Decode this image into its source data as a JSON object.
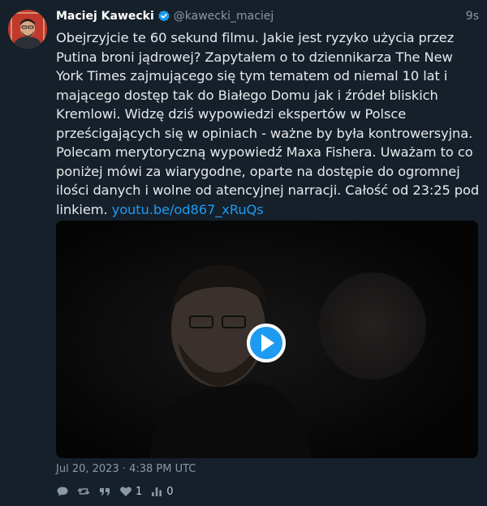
{
  "author": {
    "name": "Maciej Kawecki",
    "handle": "@kawecki_maciej",
    "verified": true
  },
  "time_ago": "9s",
  "tweet": {
    "text": "Obejrzyjcie te 60 sekund filmu. Jakie jest ryzyko użycia przez Putina broni jądrowej? Zapytałem o to dziennikarza The New York Times zajmującego się tym tematem od niemal 10 lat i mającego dostęp tak do Białego Domu jak i źródeł bliskich Kremlowi. Widzę dziś wypowiedzi ekspertów w Polsce prześcigających się w opiniach - ważne by była kontrowersyjna. Polecam merytoryczną wypowiedź Maxa Fishera. Uważam to co poniżej mówi za wiarygodne, oparte na dostępie do ogromnej ilości danych i wolne od atencyjnej narracji. Całość od 23:25 pod linkiem.",
    "link": "youtu.be/od867_xRuQs"
  },
  "media": {
    "type": "video",
    "play_icon": "play-icon"
  },
  "date": "Jul 20, 2023 · 4:38 PM UTC",
  "actions": {
    "reply_icon": "reply-icon",
    "retweet_icon": "retweet-icon",
    "quote_icon": "quote-icon",
    "like_icon": "heart-icon",
    "like_count": "1",
    "views_icon": "views-icon",
    "views_count": "0"
  },
  "colors": {
    "background": "#15202b",
    "link": "#1d9bf0",
    "verified": "#1d9bf0",
    "secondary_text": "#8b98a5"
  }
}
